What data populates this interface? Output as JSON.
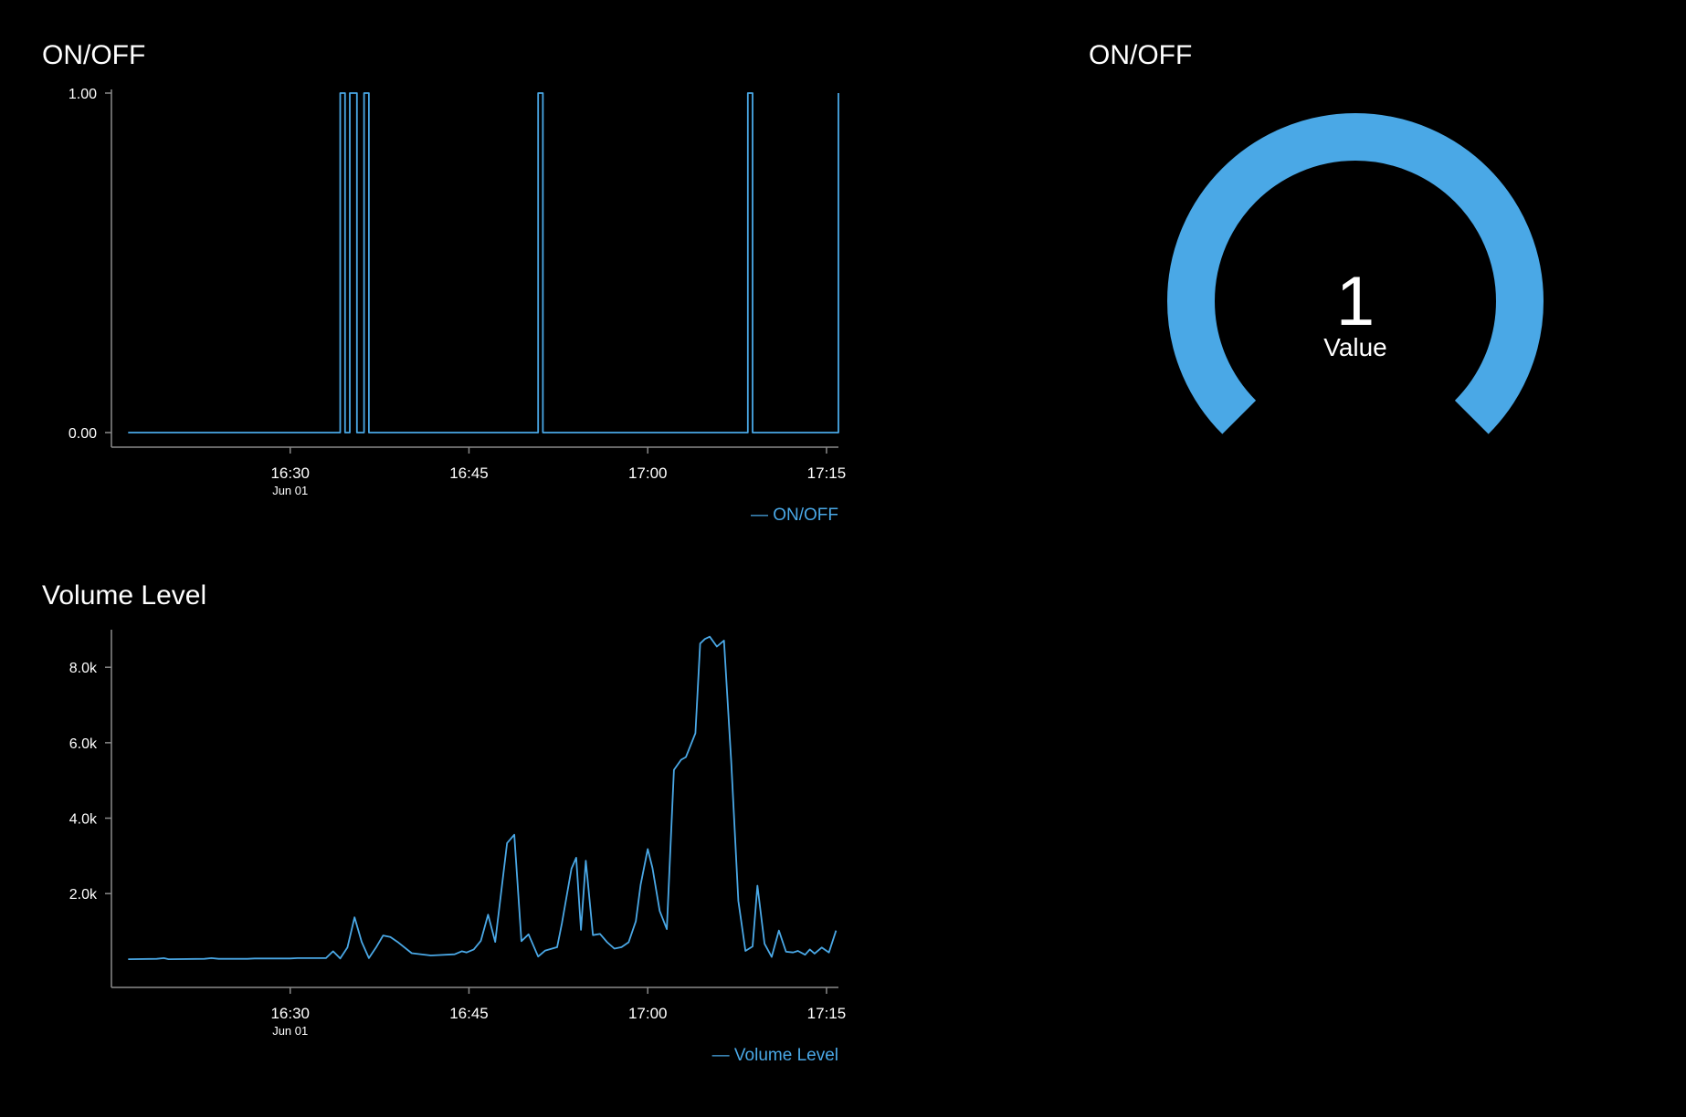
{
  "colors": {
    "background": "#000000",
    "accent": "#4aa8e6",
    "axis": "#8a8a8a",
    "text": "#ffffff"
  },
  "panels": {
    "onoff_chart": {
      "title": "ON/OFF"
    },
    "volume_chart": {
      "title": "Volume Level"
    },
    "gauge": {
      "title": "ON/OFF",
      "value": "1",
      "label": "Value",
      "fraction": 1
    }
  },
  "chart_data": [
    {
      "type": "line",
      "title": "ON/OFF",
      "x_unit": "time (hh:mm, Jun 01)",
      "x_ticks": [
        {
          "label": "16:30",
          "sub": "Jun 01",
          "value": "16:30"
        },
        {
          "label": "16:45",
          "sub": "",
          "value": "16:45"
        },
        {
          "label": "17:00",
          "sub": "",
          "value": "17:00"
        },
        {
          "label": "17:15",
          "sub": "",
          "value": "17:15"
        }
      ],
      "y_ticks": [
        {
          "label": "1.00",
          "value": 1
        },
        {
          "label": "0.00",
          "value": 0
        }
      ],
      "xlim": [
        "16:15",
        "17:16"
      ],
      "ylim": [
        0,
        1
      ],
      "legend": "bottom-right",
      "series": [
        {
          "name": "ON/OFF",
          "step": true,
          "x": [
            "16:16:24",
            "16:34:12",
            "16:34:36",
            "16:35:00",
            "16:35:36",
            "16:36:12",
            "16:36:36",
            "16:50:48",
            "16:51:12",
            "17:08:24",
            "17:08:48",
            "17:16:00"
          ],
          "y": [
            0,
            1,
            0,
            1,
            0,
            1,
            0,
            1,
            0,
            1,
            0,
            1
          ]
        }
      ]
    },
    {
      "type": "line",
      "title": "Volume Level",
      "x_unit": "time (hh:mm, Jun 01)",
      "x_ticks": [
        {
          "label": "16:30",
          "sub": "Jun 01",
          "value": "16:30"
        },
        {
          "label": "16:45",
          "sub": "",
          "value": "16:45"
        },
        {
          "label": "17:00",
          "sub": "",
          "value": "17:00"
        },
        {
          "label": "17:15",
          "sub": "",
          "value": "17:15"
        }
      ],
      "y_ticks": [
        {
          "label": "8.0k",
          "value": 8000
        },
        {
          "label": "6.0k",
          "value": 6000
        },
        {
          "label": "4.0k",
          "value": 4000
        },
        {
          "label": "2.0k",
          "value": 2000
        }
      ],
      "xlim": [
        "16:15",
        "17:16"
      ],
      "ylim": [
        -100,
        8900
      ],
      "legend": "bottom-right",
      "series": [
        {
          "name": "Volume Level",
          "x": [
            "16:16:24",
            "16:18:48",
            "16:19:24",
            "16:19:48",
            "16:22:48",
            "16:23:24",
            "16:24:00",
            "16:26:24",
            "16:27:00",
            "16:30:00",
            "16:30:36",
            "16:33:00",
            "16:33:36",
            "16:34:12",
            "16:34:48",
            "16:35:24",
            "16:36:00",
            "16:36:36",
            "16:37:12",
            "16:37:48",
            "16:38:24",
            "16:39:00",
            "16:40:12",
            "16:41:48",
            "16:42:24",
            "16:43:48",
            "16:44:24",
            "16:44:48",
            "16:45:24",
            "16:46:00",
            "16:46:36",
            "16:47:12",
            "16:48:12",
            "16:48:48",
            "16:49:24",
            "16:50:00",
            "16:50:48",
            "16:51:24",
            "16:52:24",
            "16:52:48",
            "16:53:36",
            "16:54:00",
            "16:54:24",
            "16:54:48",
            "16:55:24",
            "16:56:00",
            "16:56:36",
            "16:57:12",
            "16:57:48",
            "16:58:24",
            "16:59:00",
            "16:59:24",
            "17:00:00",
            "17:00:24",
            "17:01:00",
            "17:01:36",
            "17:02:12",
            "17:02:48",
            "17:03:12",
            "17:04:00",
            "17:04:24",
            "17:04:48",
            "17:05:12",
            "17:05:48",
            "17:06:24",
            "17:07:00",
            "17:07:36",
            "17:08:12",
            "17:08:48",
            "17:09:12",
            "17:09:48",
            "17:10:24",
            "17:11:00",
            "17:11:36",
            "17:12:12",
            "17:12:36",
            "17:13:12",
            "17:13:36",
            "17:14:00",
            "17:14:36",
            "17:15:12",
            "17:15:48"
          ],
          "y": [
            260,
            270,
            290,
            260,
            270,
            290,
            270,
            270,
            280,
            280,
            290,
            290,
            470,
            280,
            570,
            1370,
            720,
            290,
            570,
            890,
            850,
            720,
            420,
            360,
            370,
            390,
            470,
            440,
            520,
            750,
            1440,
            720,
            3340,
            3560,
            740,
            920,
            330,
            490,
            580,
            1220,
            2660,
            2950,
            1040,
            2870,
            900,
            930,
            710,
            540,
            580,
            710,
            1270,
            2230,
            3180,
            2680,
            1540,
            1060,
            5280,
            5550,
            5620,
            6250,
            8630,
            8750,
            8810,
            8550,
            8710,
            5500,
            1810,
            480,
            600,
            2210,
            670,
            320,
            1020,
            460,
            440,
            480,
            380,
            520,
            410,
            570,
            440,
            1020
          ]
        }
      ]
    }
  ]
}
